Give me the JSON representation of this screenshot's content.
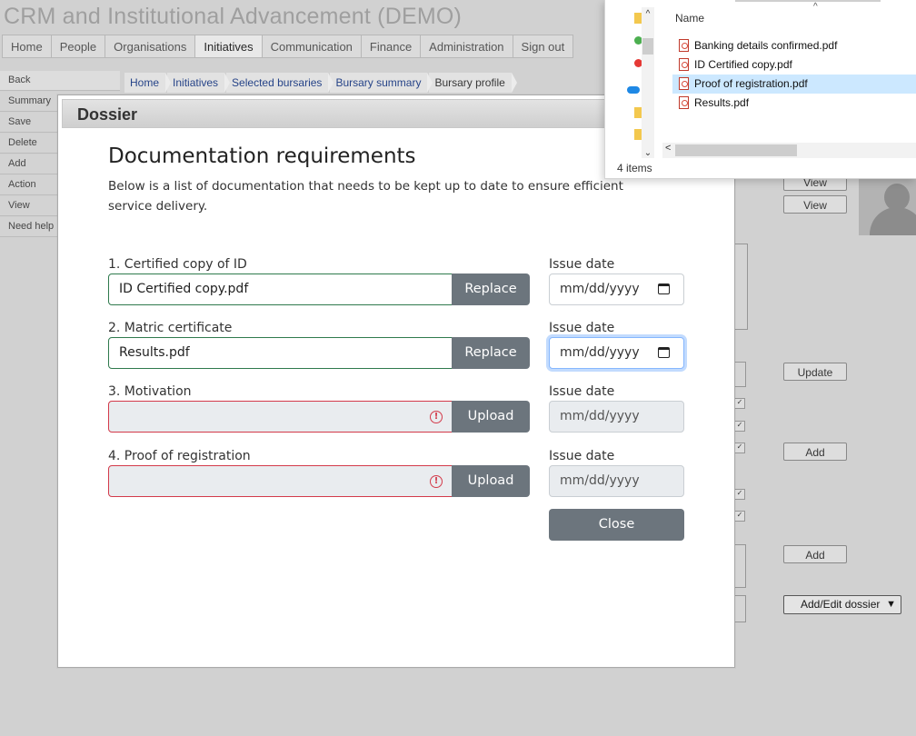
{
  "app": {
    "title": "CRM and Institutional Advancement (DEMO)"
  },
  "topnav": [
    "Home",
    "People",
    "Organisations",
    "Initiatives",
    "Communication",
    "Finance",
    "Administration",
    "Sign out"
  ],
  "sidemenu": [
    "Back",
    "Summary",
    "Save",
    "Delete",
    "Add",
    "Action",
    "View",
    "Need help"
  ],
  "breadcrumb": [
    "Home",
    "Initiatives",
    "Selected bursaries",
    "Bursary summary",
    "Bursary profile"
  ],
  "background": {
    "view_label_1": "View",
    "view_label_2": "View",
    "update_label": "Update",
    "add_label_1": "Add",
    "add_label_2": "Add",
    "dossier_select": "Add/Edit dossier"
  },
  "modal": {
    "title": "Dossier",
    "heading": "Documentation requirements",
    "description": "Below is a list of documentation that needs to be kept up to date to ensure efficient service delivery.",
    "close_label": "Close",
    "documents": [
      {
        "label": "1.  Certified copy of ID",
        "value": "ID Certified copy.pdf",
        "button": "Replace",
        "date_label": "Issue date",
        "date_placeholder": "mm/dd/yyyy",
        "valid": true
      },
      {
        "label": "2.  Matric certificate",
        "value": "Results.pdf",
        "button": "Replace",
        "date_label": "Issue date",
        "date_placeholder": "mm/dd/yyyy",
        "valid": true
      },
      {
        "label": "3.  Motivation",
        "value": "",
        "button": "Upload",
        "date_label": "Issue date",
        "date_placeholder": "mm/dd/yyyy",
        "valid": false
      },
      {
        "label": "4.  Proof of registration",
        "value": "",
        "button": "Upload",
        "date_label": "Issue date",
        "date_placeholder": "mm/dd/yyyy",
        "valid": false
      }
    ]
  },
  "explorer": {
    "column": "Name",
    "files": [
      "Banking details confirmed.pdf",
      "ID Certified copy.pdf",
      "Proof of registration.pdf",
      "Results.pdf"
    ],
    "selected_index": 2,
    "status": "4 items"
  },
  "colors": {
    "button_gray": "#6c757d",
    "valid_border": "#2f7a4d",
    "invalid_border": "#d33a4a",
    "selection": "#cce8ff"
  },
  "icons": [
    "calendar-icon",
    "error-icon",
    "pdf-file-icon",
    "scroll-up-icon",
    "scroll-down-icon",
    "scroll-left-icon",
    "sort-chevron-icon",
    "chevron-down-icon"
  ]
}
